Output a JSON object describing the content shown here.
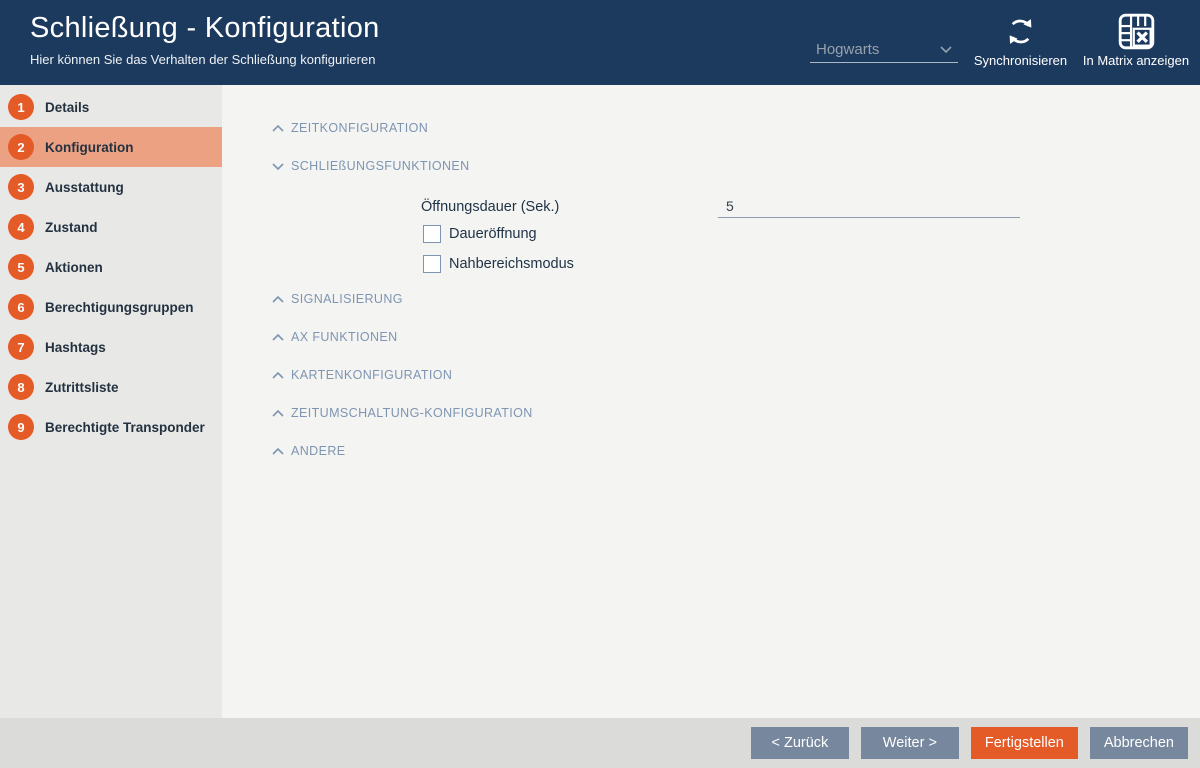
{
  "header": {
    "title": "Schließung - Konfiguration",
    "subtitle": "Hier können Sie das Verhalten der Schließung konfigurieren",
    "lock_system_select": {
      "value": "Hogwarts"
    },
    "sync_label": "Synchronisieren",
    "matrix_label": "In Matrix anzeigen"
  },
  "sidebar": {
    "active_item": "Konfiguration",
    "items": [
      {
        "number": "1",
        "label": "Details"
      },
      {
        "number": "2",
        "label": "Konfiguration"
      },
      {
        "number": "3",
        "label": "Ausstattung"
      },
      {
        "number": "4",
        "label": "Zustand"
      },
      {
        "number": "5",
        "label": "Aktionen"
      },
      {
        "number": "6",
        "label": "Berechtigungsgruppen"
      },
      {
        "number": "7",
        "label": "Hashtags"
      },
      {
        "number": "8",
        "label": "Zutrittsliste"
      },
      {
        "number": "9",
        "label": "Berechtigte Transponder"
      }
    ]
  },
  "main": {
    "sections": [
      {
        "label": "ZEITKONFIGURATION",
        "expanded": false
      },
      {
        "label": "SCHLIEßUNGSFUNKTIONEN",
        "expanded": true
      },
      {
        "label": "SIGNALISIERUNG",
        "expanded": false
      },
      {
        "label": "AX FUNKTIONEN",
        "expanded": false
      },
      {
        "label": "KARTENKONFIGURATION",
        "expanded": false
      },
      {
        "label": "ZEITUMSCHALTUNG-KONFIGURATION",
        "expanded": false
      },
      {
        "label": "ANDERE",
        "expanded": false
      }
    ],
    "schliessungsfunktionen": {
      "opening_duration_label": "Öffnungsdauer (Sek.)",
      "opening_duration_value": "5",
      "checkboxes": [
        {
          "label": "Daueröffnung",
          "checked": false
        },
        {
          "label": "Nahbereichsmodus",
          "checked": false
        }
      ]
    }
  },
  "footer": {
    "back_label": "< Zurück",
    "next_label": "Weiter >",
    "finish_label": "Fertigstellen",
    "cancel_label": "Abbrechen"
  },
  "colors": {
    "header_bg": "#1C3A5E",
    "accent_orange": "#E45B28",
    "active_step_bg": "#ECA183",
    "section_header_text": "#7E95B2",
    "gray_button_bg": "#76879E",
    "sidebar_bg": "#E8E8E7",
    "main_bg": "#F4F4F2",
    "footer_bg": "#DBDBDA"
  }
}
